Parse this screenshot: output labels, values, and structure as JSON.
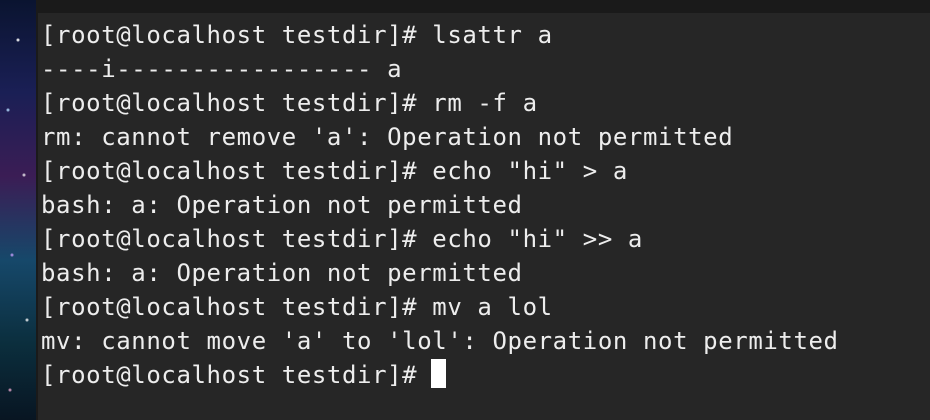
{
  "terminal": {
    "lines": [
      {
        "kind": "command",
        "text": "[root@localhost testdir]# lsattr a"
      },
      {
        "kind": "output",
        "text": "----i----------------- a"
      },
      {
        "kind": "command",
        "text": "[root@localhost testdir]# rm -f a"
      },
      {
        "kind": "output",
        "text": "rm: cannot remove 'a': Operation not permitted"
      },
      {
        "kind": "command",
        "text": "[root@localhost testdir]# echo \"hi\" > a"
      },
      {
        "kind": "output",
        "text": "bash: a: Operation not permitted"
      },
      {
        "kind": "command",
        "text": "[root@localhost testdir]# echo \"hi\" >> a"
      },
      {
        "kind": "output",
        "text": "bash: a: Operation not permitted"
      },
      {
        "kind": "command",
        "text": "[root@localhost testdir]# mv a lol"
      },
      {
        "kind": "output",
        "text": "mv: cannot move 'a' to 'lol': Operation not permitted"
      }
    ],
    "prompt": "[root@localhost testdir]#"
  }
}
